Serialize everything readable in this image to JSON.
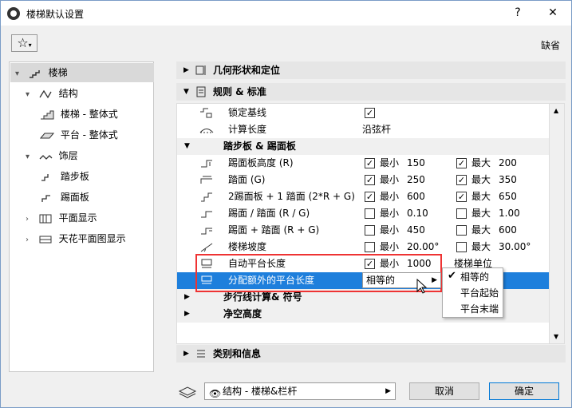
{
  "window": {
    "title": "楼梯默认设置",
    "help": "?",
    "close": "✕"
  },
  "toolbar": {
    "favorites_icon": "star-icon",
    "default_label": "缺省"
  },
  "tree": [
    {
      "label": "楼梯",
      "arrow": "▾",
      "icon": "stair-icon"
    },
    {
      "label": "结构",
      "arrow": "▾",
      "icon": "structure-icon"
    },
    {
      "label": "楼梯 - 整体式",
      "arrow": "",
      "icon": "stair-monolithic-icon"
    },
    {
      "label": "平台 - 整体式",
      "arrow": "",
      "icon": "landing-monolithic-icon"
    },
    {
      "label": "饰层",
      "arrow": "▾",
      "icon": "finish-icon"
    },
    {
      "label": "踏步板",
      "arrow": "",
      "icon": "tread-icon"
    },
    {
      "label": "踢面板",
      "arrow": "",
      "icon": "riser-icon"
    },
    {
      "label": "平面显示",
      "arrow": "›",
      "icon": "floor-plan-icon"
    },
    {
      "label": "天花平面图显示",
      "arrow": "›",
      "icon": "ceiling-plan-icon"
    }
  ],
  "sections": {
    "geometry": "几何形状和定位",
    "rules": "规则 & 标准",
    "classification": "类别和信息"
  },
  "rules_rows": [
    {
      "name": "锁定基线",
      "value": "✓"
    },
    {
      "name": "计算长度",
      "value": "沿弦杆"
    }
  ],
  "tread_riser_header": "踏步板 & 踢面板",
  "limit_rows": [
    {
      "name": "踢面板高度 (R)",
      "min_checked": true,
      "min_label": "最小",
      "min": "150",
      "max_checked": true,
      "max_label": "最大",
      "max": "200"
    },
    {
      "name": "踏面 (G)",
      "min_checked": true,
      "min_label": "最小",
      "min": "250",
      "max_checked": true,
      "max_label": "最大",
      "max": "350"
    },
    {
      "name": "2踢面板 + 1 踏面 (2*R + G)",
      "min_checked": true,
      "min_label": "最小",
      "min": "600",
      "max_checked": true,
      "max_label": "最大",
      "max": "650"
    },
    {
      "name": "踢面 / 踏面 (R / G)",
      "min_checked": false,
      "min_label": "最小",
      "min": "0.10",
      "max_checked": false,
      "max_label": "最大",
      "max": "1.00"
    },
    {
      "name": "踢面 + 踏面 (R + G)",
      "min_checked": false,
      "min_label": "最小",
      "min": "450",
      "max_checked": false,
      "max_label": "最大",
      "max": "600"
    },
    {
      "name": "楼梯坡度",
      "min_checked": false,
      "min_label": "最小",
      "min": "20.00°",
      "max_checked": false,
      "max_label": "最大",
      "max": "30.00°"
    }
  ],
  "landing_row": {
    "name": "自动平台长度",
    "min_checked": true,
    "min_label": "最小",
    "min": "1000",
    "extra": "楼梯单位"
  },
  "extra_landing_row": {
    "name": "分配额外的平台长度",
    "selected": "相等的"
  },
  "collapsed_rows": [
    "步行线计算& 符号",
    "净空高度"
  ],
  "dropdown_options": [
    {
      "label": "相等的",
      "checked": true
    },
    {
      "label": "平台起始",
      "checked": false
    },
    {
      "label": "平台末端",
      "checked": false
    }
  ],
  "footer": {
    "layer": "结构 - 楼梯&栏杆",
    "cancel": "取消",
    "ok": "确定"
  }
}
